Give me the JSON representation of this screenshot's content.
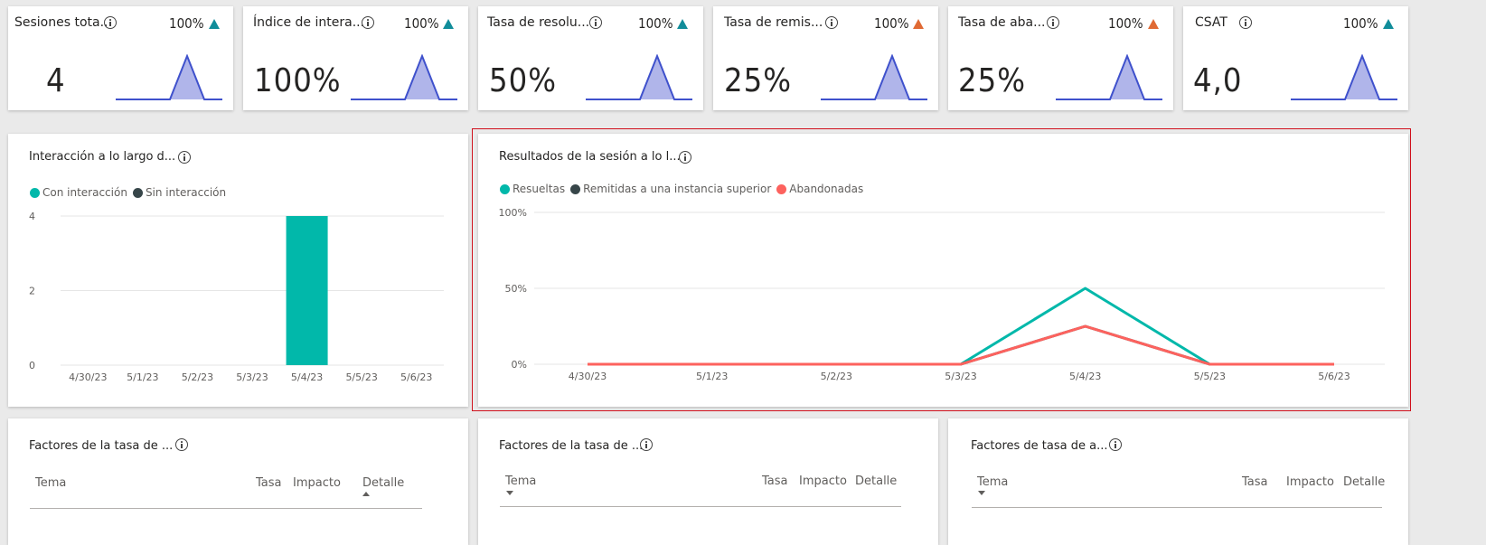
{
  "kpis": [
    {
      "title": "Sesiones tota...",
      "pct": "100%",
      "trend": "up-teal",
      "value": "4"
    },
    {
      "title": "Índice de intera...",
      "pct": "100%",
      "trend": "up-teal",
      "value": "100%"
    },
    {
      "title": "Tasa de resolu...",
      "pct": "100%",
      "trend": "up-teal",
      "value": "50%"
    },
    {
      "title": "Tasa de remis...",
      "pct": "100%",
      "trend": "up-orange",
      "value": "25%"
    },
    {
      "title": "Tasa de aba...",
      "pct": "100%",
      "trend": "up-orange",
      "value": "25%"
    },
    {
      "title": "CSAT",
      "pct": "100%",
      "trend": "up-teal",
      "value": "4,0"
    }
  ],
  "colors": {
    "teal": "#01b8aa",
    "dark": "#374649",
    "red": "#fd625e",
    "spark_line": "#3f51cc",
    "spark_fill": "#b0b5ea",
    "trend_up": "#118d9a",
    "trend_warn": "#e06a34"
  },
  "engagement": {
    "title": "Interacción a lo largo d...",
    "legend": [
      "Con interacción",
      "Sin interacción"
    ]
  },
  "outcomes": {
    "title": "Resultados de la sesión a lo l...",
    "legend": [
      "Resueltas",
      "Remitidas a una instancia superior",
      "Abandonadas"
    ]
  },
  "chart_data": [
    {
      "type": "bar",
      "categories": [
        "4/30/23",
        "5/1/23",
        "5/2/23",
        "5/3/23",
        "5/4/23",
        "5/5/23",
        "5/6/23"
      ],
      "series": [
        {
          "name": "Con interacción",
          "values": [
            0,
            0,
            0,
            0,
            4,
            0,
            0
          ]
        },
        {
          "name": "Sin interacción",
          "values": [
            0,
            0,
            0,
            0,
            0,
            0,
            0
          ]
        }
      ],
      "yticks": [
        "0",
        "2",
        "4"
      ],
      "ylim": [
        0,
        4
      ]
    },
    {
      "type": "line",
      "categories": [
        "4/30/23",
        "5/1/23",
        "5/2/23",
        "5/3/23",
        "5/4/23",
        "5/5/23",
        "5/6/23"
      ],
      "series": [
        {
          "name": "Resueltas",
          "values": [
            0,
            0,
            0,
            0,
            50,
            0,
            0
          ]
        },
        {
          "name": "Remitidas a una instancia superior",
          "values": [
            0,
            0,
            0,
            0,
            25,
            0,
            0
          ]
        },
        {
          "name": "Abandonadas",
          "values": [
            0,
            0,
            0,
            0,
            25,
            0,
            0
          ]
        }
      ],
      "yticks": [
        "0%",
        "50%",
        "100%"
      ],
      "ylim": [
        0,
        100
      ]
    }
  ],
  "tables": [
    {
      "title": "Factores de la tasa de ...",
      "headers": [
        "Tema",
        "Tasa",
        "Impacto",
        "Detalle"
      ]
    },
    {
      "title": "Factores de la tasa de ...",
      "headers": [
        "Tema",
        "Tasa",
        "Impacto",
        "Detalle"
      ]
    },
    {
      "title": "Factores de tasa de a...",
      "headers": [
        "Tema",
        "Tasa",
        "Impacto",
        "Detalle"
      ]
    }
  ]
}
